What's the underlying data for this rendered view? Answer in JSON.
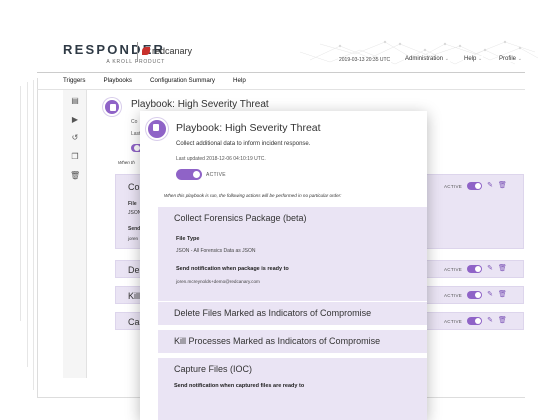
{
  "header": {
    "logo": "RESPONDER",
    "logo_sub": "A KROLL PRODUCT",
    "partner_logo": "redcanary",
    "datetime": "2019-03-13 20:35 UTC",
    "menus": [
      "Administration",
      "Help",
      "Profile"
    ]
  },
  "nav": {
    "items": [
      "Triggers",
      "Playbooks",
      "Configuration Summary",
      "Help"
    ]
  },
  "sidebar": {
    "icons": [
      "document-icon",
      "play-icon",
      "history-icon",
      "copy-icon",
      "trash-icon"
    ]
  },
  "back_panel": {
    "title": "Playbook: High Severity Threat",
    "frag_desc": "Co",
    "frag_updated": "Last",
    "frag_when": "When th",
    "rows": [
      {
        "label": "Col",
        "sub1": "File",
        "sub2": "JSON",
        "sub3": "Send",
        "sub4": "joren"
      },
      {
        "label": "Dele"
      },
      {
        "label": "Kill"
      },
      {
        "label": "Capt"
      }
    ],
    "active_label": "ACTIVE"
  },
  "card": {
    "title": "Playbook: High Severity Threat",
    "description": "Collect additional data to inform incident response.",
    "updated": "Last updated 2018-12-06 04:10:19 UTC.",
    "status": "ACTIVE",
    "when_note": "When this playbook is run, the following actions will be performed in no particular order:",
    "sections": [
      {
        "title": "Collect Forensics Package (beta)",
        "file_type_label": "File Type",
        "file_type_value": "JSON - All Forensics Data as JSON",
        "notify_label": "Send notification when package is ready to",
        "notify_value": "joren.mcreynolds+demo@redcanary.com"
      },
      {
        "title": "Delete Files Marked as Indicators of Compromise"
      },
      {
        "title": "Kill Processes Marked as Indicators of Compromise"
      },
      {
        "title": "Capture Files (IOC)",
        "notify_label": "Send notification when captured files are ready to"
      }
    ]
  },
  "colors": {
    "accent": "#8f63c7",
    "row_bg": "#eae4f4",
    "brand_red": "#c8302c"
  }
}
